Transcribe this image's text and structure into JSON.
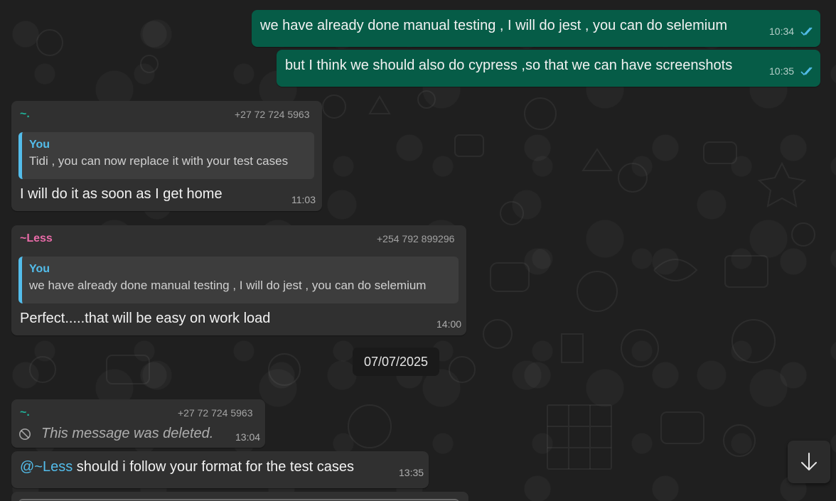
{
  "messages": [
    {
      "text": "we have already done manual testing , I will do jest , you can do selemium",
      "time": "10:34"
    },
    {
      "text": "but I think we should also do cypress ,so that we can have screenshots",
      "time": "10:35"
    },
    {
      "sender": "~.",
      "phone": "+27 72 724 5963",
      "quote_author": "You",
      "quote_text": "Tidi , you can now replace it with your test cases",
      "text": "I will do it as soon as I get home",
      "time": "11:03"
    },
    {
      "sender": "~Less",
      "phone": "+254 792 899296",
      "quote_author": "You",
      "quote_text": "we have already done manual testing , I will do jest , you can do selemium",
      "text": "Perfect.....that will be easy on work load",
      "time": "14:00"
    },
    {
      "sender": "~.",
      "phone": "+27 72 724 5963",
      "text": "This message was deleted.",
      "time": "13:04"
    },
    {
      "mention": "@~Less",
      "text": " should  i follow your format for the test cases",
      "time": "13:35"
    }
  ],
  "date_divider": "07/07/2025",
  "icons": {
    "read_receipt": "double-check-icon",
    "deleted": "prohibited-icon",
    "scroll_down": "arrow-down-icon"
  },
  "colors": {
    "outgoing_bubble": "#065c47",
    "incoming_bubble": "#303030",
    "sender_teal": "#20b39a",
    "sender_pink": "#e96ba8",
    "quote_accent": "#53bdeb",
    "read_tick": "#53bdeb"
  }
}
